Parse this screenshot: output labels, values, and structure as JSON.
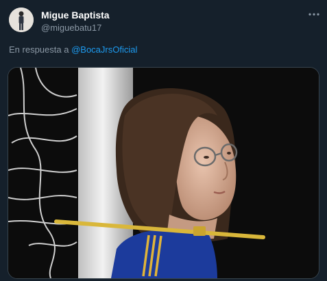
{
  "tweet": {
    "author_name": "Migue Baptista",
    "author_handle": "@miguebatu17",
    "reply_prefix": "En respuesta a",
    "reply_mention": "@BocaJrsOficial"
  },
  "icons": {
    "more": "more-horizontal-icon",
    "avatar": "profile-photo"
  },
  "colors": {
    "background": "#15202b",
    "secondary_text": "#8b98a5",
    "link": "#1d9bf0"
  }
}
